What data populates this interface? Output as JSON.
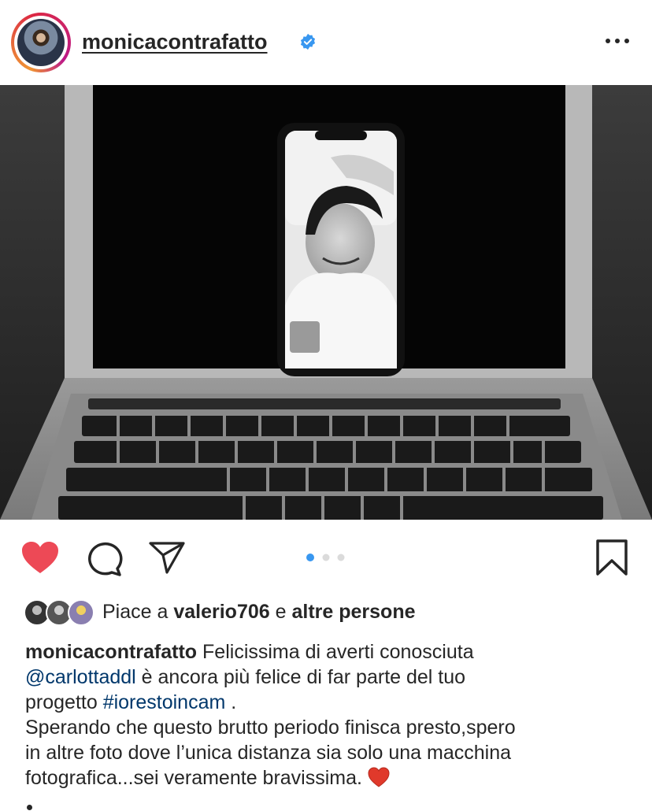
{
  "post": {
    "username": "monicacontrafatto",
    "verified": true,
    "photo": {
      "description_icon": "laptop-with-phone-photo",
      "repost_username": "carlottaddl"
    },
    "actions": {
      "like": "heart-filled-icon",
      "comment": "comment-icon",
      "share": "send-icon",
      "save": "bookmark-icon",
      "carousel_index": 1,
      "carousel_total": 3
    },
    "likes": {
      "prefix": "Piace a",
      "user": "valerio706",
      "connector": "e",
      "others": "altre persone"
    },
    "caption": {
      "author": "monicacontrafatto",
      "text1": " Felicissima di averti conosciuta",
      "mention": "@carlottaddl",
      "text2": " è ancora più felice di far parte del tuo",
      "text3": "progetto ",
      "hashtag": "#iorestoincam",
      "text4": " .",
      "line4": "Sperando che questo brutto periodo finisca presto,spero",
      "line5": "in altre foto dove l’unica distanza sia solo una macchina",
      "line6": "fotografica...sei veramente bravissima."
    }
  },
  "colors": {
    "like_red": "#ed4956",
    "link_blue": "#00376b",
    "verified_blue": "#3897f0",
    "carousel_active": "#3897f0",
    "carousel_inactive": "#dbdbdb"
  }
}
